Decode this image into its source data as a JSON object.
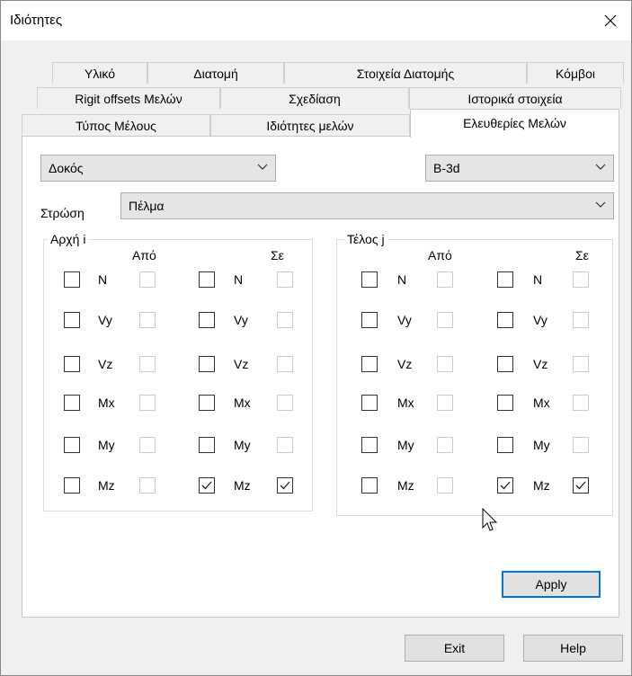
{
  "window": {
    "title": "Ιδιότητες"
  },
  "tabs": {
    "row1": [
      "Υλικό",
      "Διατομή",
      "Στοιχεία Διατομής",
      "Κόμβοι"
    ],
    "row2": [
      "Rigit offsets Μελών",
      "Σχεδίαση",
      "Ιστορικά στοιχεία"
    ],
    "row3": [
      "Τύπος Μέλους",
      "Ιδιότητες μελών",
      "Ελευθερίες Μελών"
    ],
    "active": "Ελευθερίες Μελών"
  },
  "member_type": {
    "value": "Δοκός"
  },
  "element_type": {
    "value": "B-3d"
  },
  "layer": {
    "label": "Στρώση",
    "value": "Πέλμα"
  },
  "start_group": {
    "title": "Αρχή i",
    "from_label": "Από",
    "to_label": "Σε",
    "rows": [
      "N",
      "Vy",
      "Vz",
      "Mx",
      "My",
      "Mz"
    ],
    "from_checked": [
      false,
      false,
      false,
      false,
      false,
      false
    ],
    "to_checked": [
      false,
      false,
      false,
      false,
      false,
      true
    ]
  },
  "end_group": {
    "title": "Τέλος j",
    "from_label": "Από",
    "to_label": "Σε",
    "rows": [
      "N",
      "Vy",
      "Vz",
      "Mx",
      "My",
      "Mz"
    ],
    "from_checked": [
      false,
      false,
      false,
      false,
      false,
      false
    ],
    "to_checked": [
      false,
      false,
      false,
      false,
      false,
      true
    ]
  },
  "buttons": {
    "apply": "Apply",
    "exit": "Exit",
    "help": "Help"
  },
  "icons": {
    "close": "close-icon",
    "chevron": "chevron-down-icon",
    "cursor": "mouse-pointer-icon"
  }
}
